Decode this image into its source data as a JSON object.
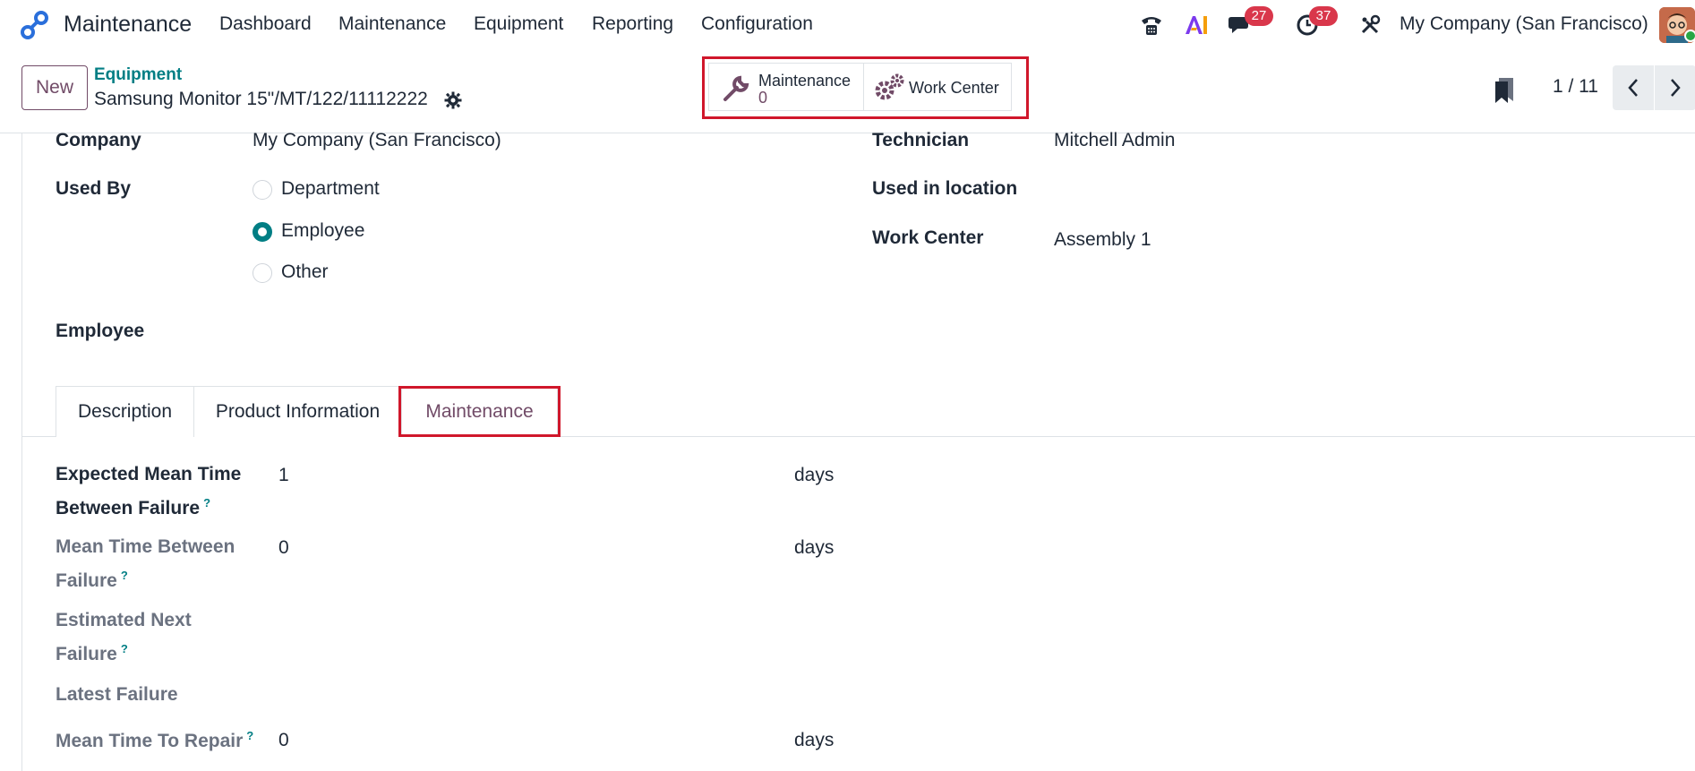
{
  "nav": {
    "app_name": "Maintenance",
    "menu": [
      "Dashboard",
      "Maintenance",
      "Equipment",
      "Reporting",
      "Configuration"
    ],
    "messages_badge": "27",
    "activities_badge": "37",
    "company": "My Company (San Francisco)"
  },
  "control": {
    "new_label": "New",
    "breadcrumb": "Equipment",
    "record_title": "Samsung Monitor 15\"/MT/122/11112222",
    "smart_maintenance_label": "Maintenance",
    "smart_maintenance_value": "0",
    "smart_workcenter_label": "Work Center",
    "pager": "1 / 11"
  },
  "form": {
    "company_label": "Company",
    "company_value": "My Company (San Francisco)",
    "used_by_label": "Used By",
    "used_by_options": [
      "Department",
      "Employee",
      "Other"
    ],
    "used_by_selected": "Employee",
    "employee_label": "Employee",
    "technician_label": "Technician",
    "technician_value": "Mitchell Admin",
    "location_label": "Used in location",
    "workcenter_label": "Work Center",
    "workcenter_value": "Assembly 1"
  },
  "tabs": [
    "Description",
    "Product Information",
    "Maintenance"
  ],
  "active_tab": "Maintenance",
  "maintenance_tab": {
    "mtbf_expected_label_1": "Expected Mean Time",
    "mtbf_expected_label_2": "Between Failure",
    "mtbf_expected_value": "1",
    "mtbf_label_1": "Mean Time Between",
    "mtbf_label_2": "Failure",
    "mtbf_value": "0",
    "estimated_label_1": "Estimated Next",
    "estimated_label_2": "Failure",
    "latest_failure_label": "Latest Failure",
    "mttr_label": "Mean Time To Repair",
    "mttr_value": "0",
    "unit_days": "days",
    "help_mark": "?"
  },
  "colors": {
    "brand": "#714b67",
    "teal": "#017e84",
    "badge": "#d9374b",
    "highlight": "#d0172b"
  }
}
